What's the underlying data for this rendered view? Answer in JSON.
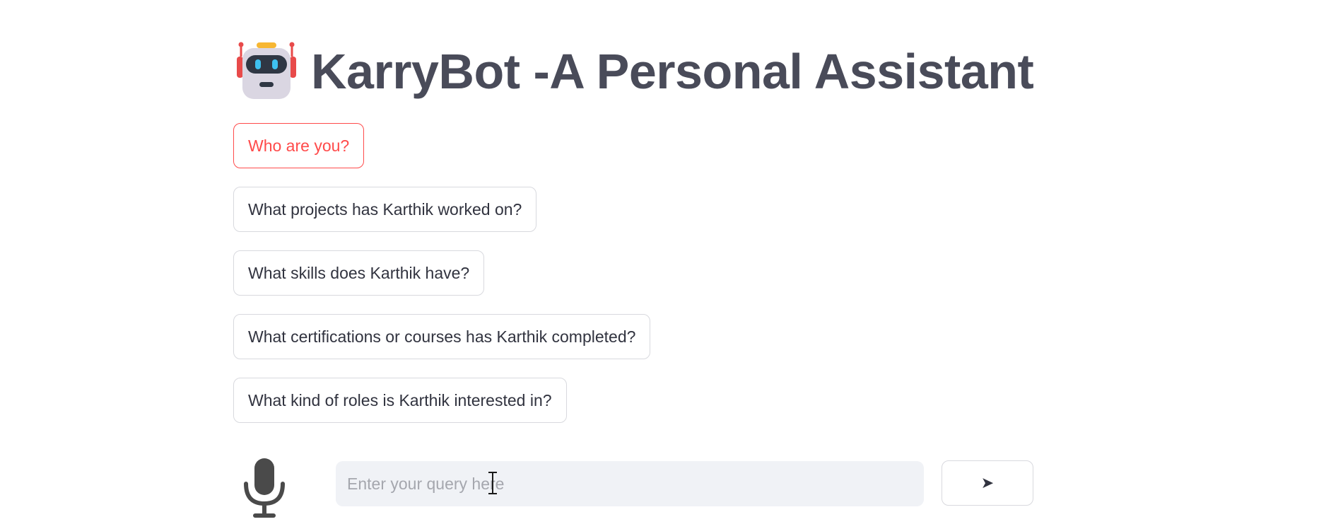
{
  "app": {
    "title": "KarryBot -A Personal Assistant",
    "icon": "robot-icon"
  },
  "suggestions": [
    {
      "label": "Who are you?",
      "active": true
    },
    {
      "label": "What projects has Karthik worked on?",
      "active": false
    },
    {
      "label": "What skills does Karthik have?",
      "active": false
    },
    {
      "label": "What certifications or courses has Karthik completed?",
      "active": false
    },
    {
      "label": "What kind of roles is Karthik interested in?",
      "active": false
    }
  ],
  "input": {
    "placeholder": "Enter your query here",
    "value": ""
  },
  "send": {
    "label": "➤",
    "icon": "send-arrow-icon"
  },
  "mic": {
    "icon": "microphone-icon"
  },
  "colors": {
    "accent": "#ff4b4b",
    "title": "#494b59",
    "text": "#31333f",
    "input_bg": "#f0f2f6",
    "border": "#d8d9de"
  }
}
